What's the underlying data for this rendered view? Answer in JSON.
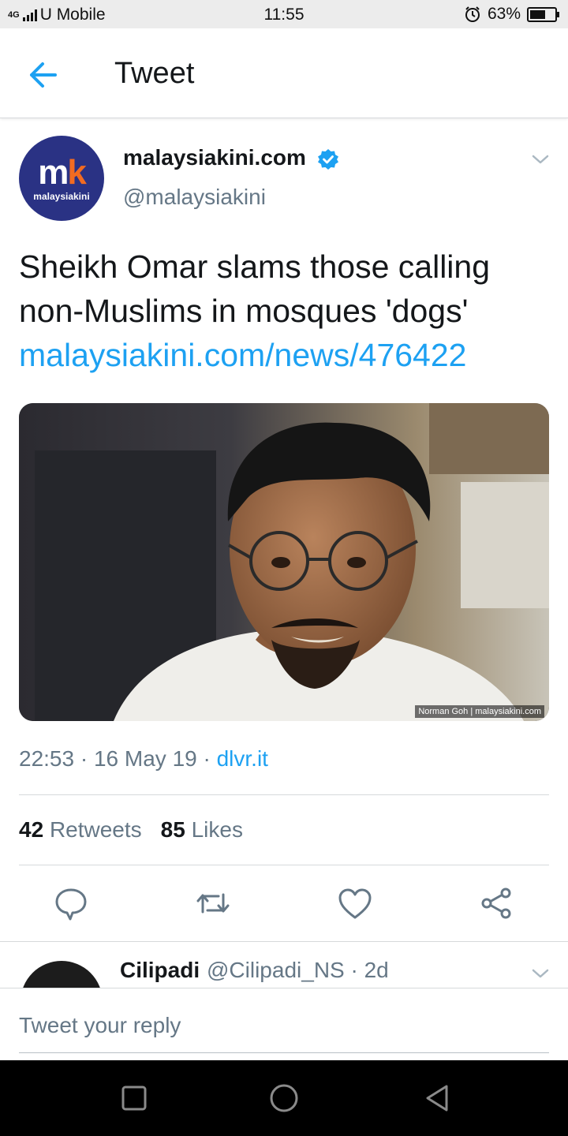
{
  "status_bar": {
    "network": "4G",
    "carrier": "U Mobile",
    "time": "11:55",
    "battery": "63%",
    "battery_level": 0.63
  },
  "header": {
    "title": "Tweet"
  },
  "tweet": {
    "avatar": {
      "mark": "m",
      "mark_accent": "k",
      "name": "malaysiakini"
    },
    "display_name": "malaysiakini.com",
    "handle": "@malaysiakini",
    "text": "Sheikh Omar slams those calling non-Muslims in mosques 'dogs'",
    "link": "malaysiakini.com/news/476422",
    "media_credit": "Norman Goh | malaysiakini.com",
    "time": "22:53",
    "date": "16 May 19",
    "source": "dlvr.it",
    "retweets_count": "42",
    "retweets_label": "Retweets",
    "likes_count": "85",
    "likes_label": "Likes"
  },
  "reply_preview": {
    "name": "Cilipadi",
    "handle_time": "@Cilipadi_NS · 2d"
  },
  "reply_box": {
    "placeholder": "Tweet your reply"
  },
  "colors": {
    "accent": "#1da1f2",
    "text": "#14171a",
    "muted": "#657786",
    "brand_navy": "#2a3284",
    "brand_orange": "#f26b21"
  },
  "icons": [
    "back-arrow-icon",
    "verified-badge-icon",
    "chevron-down-icon",
    "reply-icon",
    "retweet-icon",
    "like-icon",
    "share-icon",
    "nav-recents-icon",
    "nav-home-icon",
    "nav-back-icon"
  ]
}
